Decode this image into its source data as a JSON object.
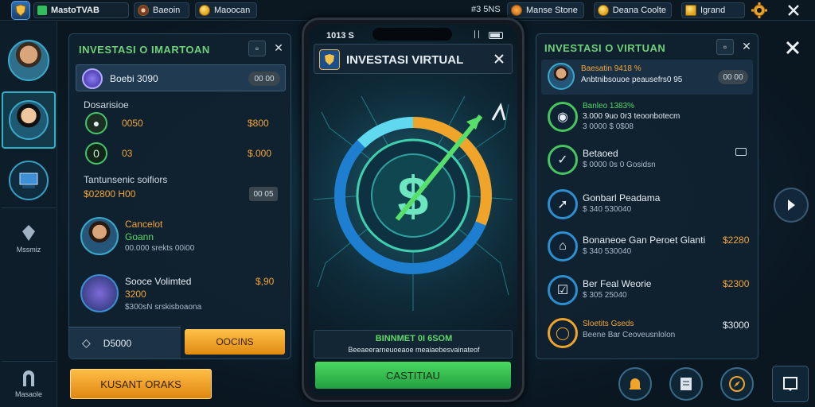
{
  "topbar": {
    "app_name": "MastoTVAB",
    "profile_label": "Baeoin",
    "gold_label": "Maoocan",
    "center_value": "#3 5NS",
    "pill1": "Manse Stone",
    "pill2": "Deana Coolte",
    "pill3": "Igrand"
  },
  "leftrail": {
    "item3_label": "Mssmiz",
    "item4_label": "Masaole"
  },
  "left_panel": {
    "title": "INVESTASI O IMARTOAN",
    "selected_label": "Boebi 3090",
    "selected_pill": "00 00",
    "section_label": "Dosarisioe",
    "rows": [
      {
        "left": "0050",
        "right": "$800"
      },
      {
        "left": "03",
        "right": "$.000"
      }
    ],
    "group_title": "Tantunsenic soifiors",
    "group_sub": "$02800 H00",
    "group_pill": "00 05",
    "profiles": [
      {
        "name": "Cancelot",
        "name2": "Goann",
        "meta": "00.000 srekts 00i00"
      },
      {
        "name": "Sooce Volimted",
        "name2": "3200",
        "meta": "$300sN srskisboaona",
        "value": "$,90"
      }
    ],
    "btn_left": "D5000",
    "btn_right": "OOCINS"
  },
  "bottom_left_button": "KUSANT ORAKS",
  "phone": {
    "time": "1013 S",
    "signal": "∣∣",
    "title": "INVESTASI VIRTUAL",
    "info_title": "BINNMET 0I 6SOM",
    "info_sub": "Beeaeerarneuoeaoe meaiaebesvainateof",
    "cta": "CASTITIAU"
  },
  "right_panel": {
    "title": "INVESTASI O VIRTUAN",
    "top_item": {
      "title": "Baesatin 9418 %",
      "sub": "Anbtnibsouoe peausefrs0 95",
      "pill": "00 00"
    },
    "items": [
      {
        "title": "Banleo 1383%",
        "sub": "3.000 9uo 0r3 teoonbotecm",
        "sub2": "3 0000 $ 0$08",
        "value": ""
      },
      {
        "title": "Betaoed",
        "sub": "$ 0000 0s 0 Gosidsn",
        "value": ""
      },
      {
        "title": "Gonbarl Peadama",
        "sub": "$ 340 530040",
        "value": ""
      },
      {
        "title": "Bonaneoe Gan Peroet Glanti",
        "sub": "$ 340 530040",
        "value": "$2280"
      },
      {
        "title": "Ber Feal Weorie",
        "sub": "$ 305 25040",
        "value": "$2300"
      },
      {
        "title": "Sloetits Gseds",
        "sub": "Beene Bar Ceoveusnlolon",
        "value": "$3000"
      }
    ]
  },
  "colors": {
    "accent_gold": "#f2a63a",
    "accent_green": "#2fbf5c",
    "panel_border": "#2a4a5e"
  },
  "icons": [
    "shield-icon",
    "close-icon",
    "gear-icon",
    "chevron-right-icon",
    "bell-icon",
    "document-icon",
    "compass-icon",
    "window-icon"
  ]
}
